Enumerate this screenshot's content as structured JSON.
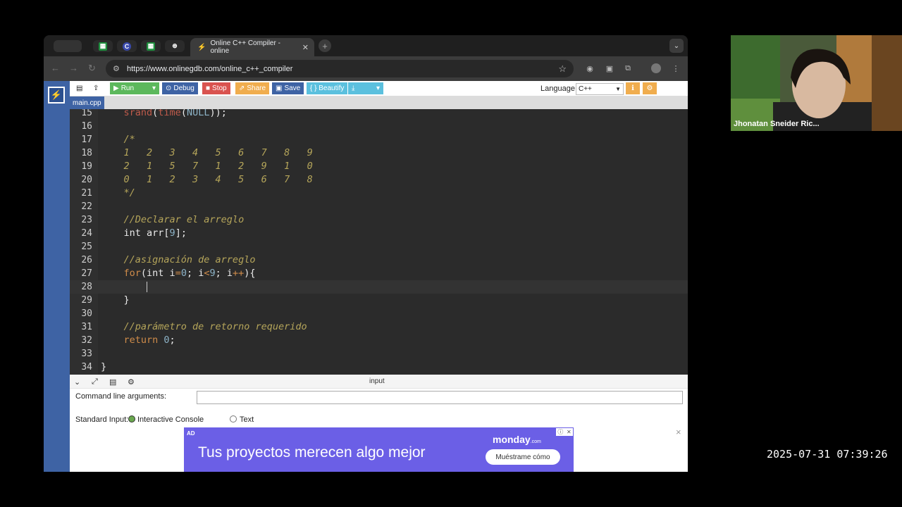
{
  "browser": {
    "pinned_tabs": [
      {
        "icon": "sheets-icon",
        "glyph": "▦",
        "color": "#1e8e3e"
      },
      {
        "icon": "c-icon",
        "glyph": "C",
        "color": "#3949ab"
      },
      {
        "icon": "sheets-icon",
        "glyph": "▦",
        "color": "#1e8e3e"
      },
      {
        "icon": "openai-icon",
        "glyph": "⊛",
        "color": "#ffffff"
      }
    ],
    "active_tab_title": "Online C++ Compiler - online",
    "url": "https://www.onlinegdb.com/online_c++_compiler"
  },
  "toolbar": {
    "run_label": "Run",
    "debug_label": "Debug",
    "stop_label": "Stop",
    "share_label": "Share",
    "save_label": "Save",
    "beautify_label": "{ } Beautify",
    "language_label": "Language",
    "language_value": "C++",
    "colors": {
      "run": "#5cb85c",
      "debug": "#3e63a4",
      "stop": "#d9534f",
      "share": "#f0ad4e",
      "save": "#3e63a4",
      "beautify": "#5bc0de",
      "download": "#5bc0de",
      "info": "#f0ad4e"
    }
  },
  "file_tab": "main.cpp",
  "code": [
    {
      "n": "15",
      "parts": [
        [
          "fn",
          "    srand"
        ],
        [
          "",
          "("
        ],
        [
          "fn",
          "time"
        ],
        [
          "",
          "("
        ],
        [
          "num",
          "NULL"
        ],
        [
          "",
          "));"
        ]
      ]
    },
    {
      "n": "16",
      "parts": []
    },
    {
      "n": "17",
      "parts": [
        [
          "cmt",
          "    /*"
        ]
      ]
    },
    {
      "n": "18",
      "parts": [
        [
          "cmt",
          "    1   2   3   4   5   6   7   8   9"
        ]
      ]
    },
    {
      "n": "19",
      "parts": [
        [
          "cmt",
          "    2   1   5   7   1   2   9   1   0"
        ]
      ]
    },
    {
      "n": "20",
      "parts": [
        [
          "cmt",
          "    0   1   2   3   4   5   6   7   8"
        ]
      ]
    },
    {
      "n": "21",
      "parts": [
        [
          "cmt",
          "    */"
        ]
      ]
    },
    {
      "n": "22",
      "parts": []
    },
    {
      "n": "23",
      "parts": [
        [
          "cmt",
          "    //Declarar el arreglo"
        ]
      ]
    },
    {
      "n": "24",
      "parts": [
        [
          "",
          "    int arr["
        ],
        [
          "num",
          "9"
        ],
        [
          "",
          "];"
        ]
      ]
    },
    {
      "n": "25",
      "parts": []
    },
    {
      "n": "26",
      "parts": [
        [
          "cmt",
          "    //asignación de arreglo"
        ]
      ]
    },
    {
      "n": "27",
      "parts": [
        [
          "kw",
          "    for"
        ],
        [
          "",
          "(int i"
        ],
        [
          "kw",
          "="
        ],
        [
          "num",
          "0"
        ],
        [
          "",
          "; i"
        ],
        [
          "kw",
          "<"
        ],
        [
          "num",
          "9"
        ],
        [
          "",
          "; i"
        ],
        [
          "kw",
          "++"
        ],
        [
          "",
          "){"
        ]
      ]
    },
    {
      "n": "28",
      "parts": []
    },
    {
      "n": "29",
      "parts": [
        [
          "",
          "    }"
        ]
      ]
    },
    {
      "n": "30",
      "parts": []
    },
    {
      "n": "31",
      "parts": [
        [
          "cmt",
          "    //parámetro de retorno requerido"
        ]
      ]
    },
    {
      "n": "32",
      "parts": [
        [
          "kw",
          "    return "
        ],
        [
          "num",
          "0"
        ],
        [
          "",
          ";"
        ]
      ]
    },
    {
      "n": "33",
      "parts": []
    },
    {
      "n": "34",
      "parts": [
        [
          "",
          "}"
        ]
      ]
    }
  ],
  "active_line": "28",
  "input_panel": {
    "title": "input",
    "cla_label": "Command line arguments:",
    "stdin_label": "Standard Input:",
    "option_interactive": "Interactive Console",
    "option_text": "Text",
    "selected": "Interactive Console"
  },
  "ad": {
    "tag": "AD",
    "headline": "Tus proyectos merecen algo mejor",
    "brand": "monday",
    "brand_suffix": ".com",
    "button": "Muéstrame cómo"
  },
  "participant": {
    "name": "Jhonatan Sneider Ric..."
  },
  "timestamp": "2025-07-31 07:39:26"
}
